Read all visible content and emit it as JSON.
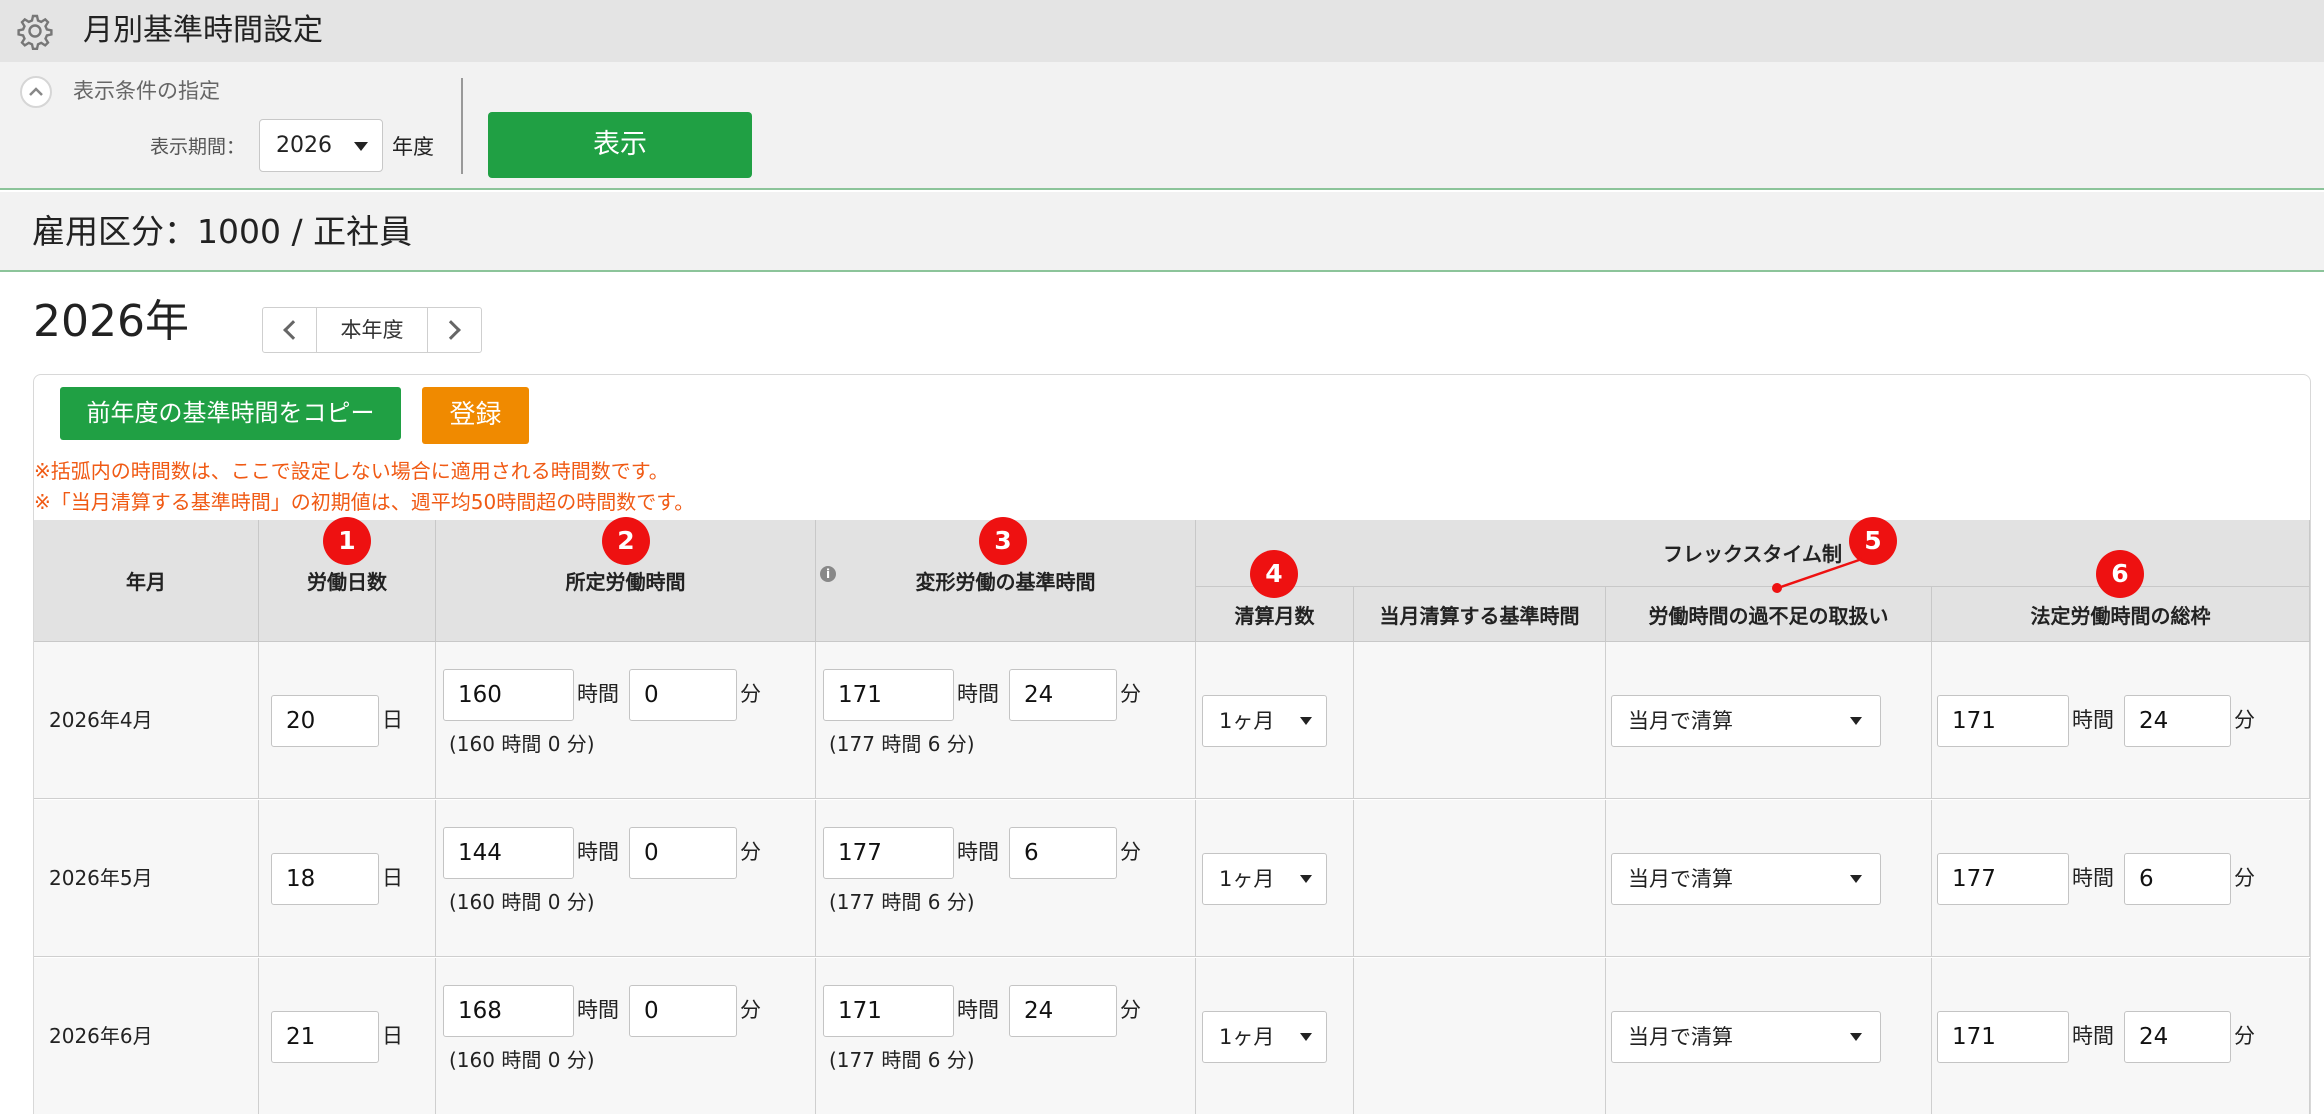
{
  "header": {
    "title": "月別基準時間設定",
    "icon": "gear-icon"
  },
  "filter": {
    "collapse_label": "表示条件の指定",
    "period_label": "表示期間：",
    "year_value": "2026",
    "year_unit": "年度",
    "show_button": "表示"
  },
  "employment": {
    "text": "雇用区分：1000 / 正社員"
  },
  "year_nav": {
    "heading": "2026年",
    "current_label": "本年度"
  },
  "actions": {
    "copy_button": "前年度の基準時間をコピー",
    "register_button": "登録"
  },
  "notes": [
    "※括弧内の時間数は、ここで設定しない場合に適用される時間数です。",
    "※「当月清算する基準時間」の初期値は、週平均50時間超の時間数です。"
  ],
  "columns": {
    "year_month": "年月",
    "work_days": "労働日数",
    "scheduled_hours": "所定労働時間",
    "variable_hours": "変形労働の基準時間",
    "flex_group": "フレックスタイム制",
    "settlement_months": "清算月数",
    "monthly_settlement_hours": "当月清算する基準時間",
    "excess_shortage": "労働時間の過不足の取扱い",
    "legal_total": "法定労働時間の総枠"
  },
  "badges": [
    "1",
    "2",
    "3",
    "4",
    "5",
    "6"
  ],
  "units": {
    "day": "日",
    "hour": "時間",
    "minute": "分"
  },
  "rows": [
    {
      "year_month": "2026年4月",
      "days": "20",
      "scheduled_h": "160",
      "scheduled_m": "0",
      "scheduled_default": "(160 時間 0 分)",
      "variable_h": "171",
      "variable_m": "24",
      "variable_default": "(177 時間 6 分)",
      "settlement": "1ヶ月",
      "handling": "当月で清算",
      "legal_h": "171",
      "legal_m": "24"
    },
    {
      "year_month": "2026年5月",
      "days": "18",
      "scheduled_h": "144",
      "scheduled_m": "0",
      "scheduled_default": "(160 時間 0 分)",
      "variable_h": "177",
      "variable_m": "6",
      "variable_default": "(177 時間 6 分)",
      "settlement": "1ヶ月",
      "handling": "当月で清算",
      "legal_h": "177",
      "legal_m": "6"
    },
    {
      "year_month": "2026年6月",
      "days": "21",
      "scheduled_h": "168",
      "scheduled_m": "0",
      "scheduled_default": "(160 時間 0 分)",
      "variable_h": "171",
      "variable_m": "24",
      "variable_default": "(177 時間 6 分)",
      "settlement": "1ヶ月",
      "handling": "当月で清算",
      "legal_h": "171",
      "legal_m": "24"
    }
  ],
  "colors": {
    "primary_green": "#20a044",
    "register_orange": "#f08a00",
    "note_text": "#f05a14",
    "badge_red": "#ee1111"
  }
}
